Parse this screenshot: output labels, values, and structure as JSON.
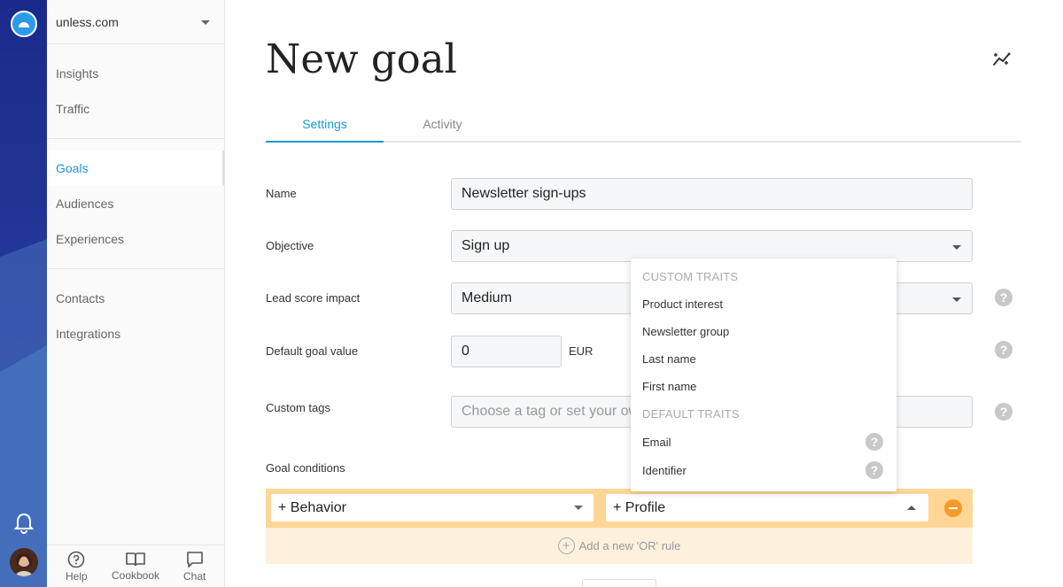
{
  "app": {
    "workspace": "unless.com"
  },
  "nav": {
    "group1": [
      "Insights",
      "Traffic"
    ],
    "group2": [
      "Goals",
      "Audiences",
      "Experiences"
    ],
    "group3": [
      "Contacts",
      "Integrations"
    ],
    "active": "Goals"
  },
  "footer": {
    "help": "Help",
    "cookbook": "Cookbook",
    "chat": "Chat"
  },
  "page": {
    "title": "New goal"
  },
  "tabs": [
    "Settings",
    "Activity"
  ],
  "form": {
    "name_label": "Name",
    "name_value": "Newsletter sign-ups",
    "objective_label": "Objective",
    "objective_value": "Sign up",
    "lead_label": "Lead score impact",
    "lead_value": "Medium",
    "default_label": "Default goal value",
    "default_value": "0",
    "currency": "EUR",
    "tags_label": "Custom tags",
    "tags_placeholder": "Choose a tag or set your own",
    "conditions_label": "Goal conditions",
    "behavior": "+ Behavior",
    "profile": "+ Profile",
    "add_or": "Add a new 'OR' rule"
  },
  "dropdown": {
    "custom_heading": "CUSTOM TRAITS",
    "custom_items": [
      "Product interest",
      "Newsletter group",
      "Last name",
      "First name"
    ],
    "default_heading": "DEFAULT TRAITS",
    "default_items": [
      "Email",
      "Identifier"
    ]
  },
  "colors": {
    "accent": "#1a9ad6",
    "rail": "#1e2f8f",
    "condition": "#ffd696",
    "remove": "#f59a2b"
  },
  "icons": [
    "logo-icon",
    "bell-icon",
    "help-icon",
    "cookbook-icon",
    "chat-icon",
    "magic-wand-icon",
    "question-icon",
    "plus-circle-icon",
    "minus-icon"
  ]
}
